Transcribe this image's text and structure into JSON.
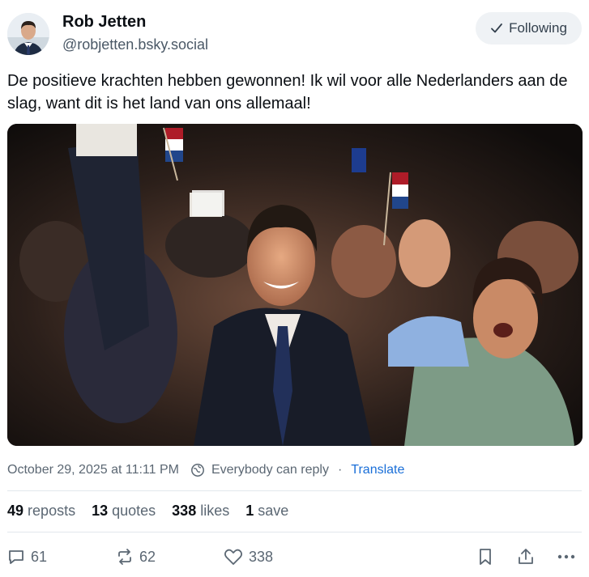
{
  "author": {
    "name": "Rob Jetten",
    "handle": "@robjetten.bsky.social",
    "follow_label": "Following"
  },
  "post": {
    "text": "De positieve krachten hebben gewonnen! Ik wil voor alle Nederlanders aan de slag, want dit is het land van ons allemaal!"
  },
  "meta": {
    "timestamp": "October 29, 2025 at 11:11 PM",
    "reply_setting": "Everybody can reply",
    "separator": "·",
    "translate_label": "Translate"
  },
  "stats": {
    "reposts_count": "49",
    "reposts_label": "reposts",
    "quotes_count": "13",
    "quotes_label": "quotes",
    "likes_count": "338",
    "likes_label": "likes",
    "saves_count": "1",
    "saves_label": "save"
  },
  "actions": {
    "reply_count": "61",
    "repost_count": "62",
    "like_count": "338"
  },
  "colors": {
    "accent": "#1a6fd8",
    "muted": "#5b6773",
    "button_bg": "#eff2f5"
  }
}
